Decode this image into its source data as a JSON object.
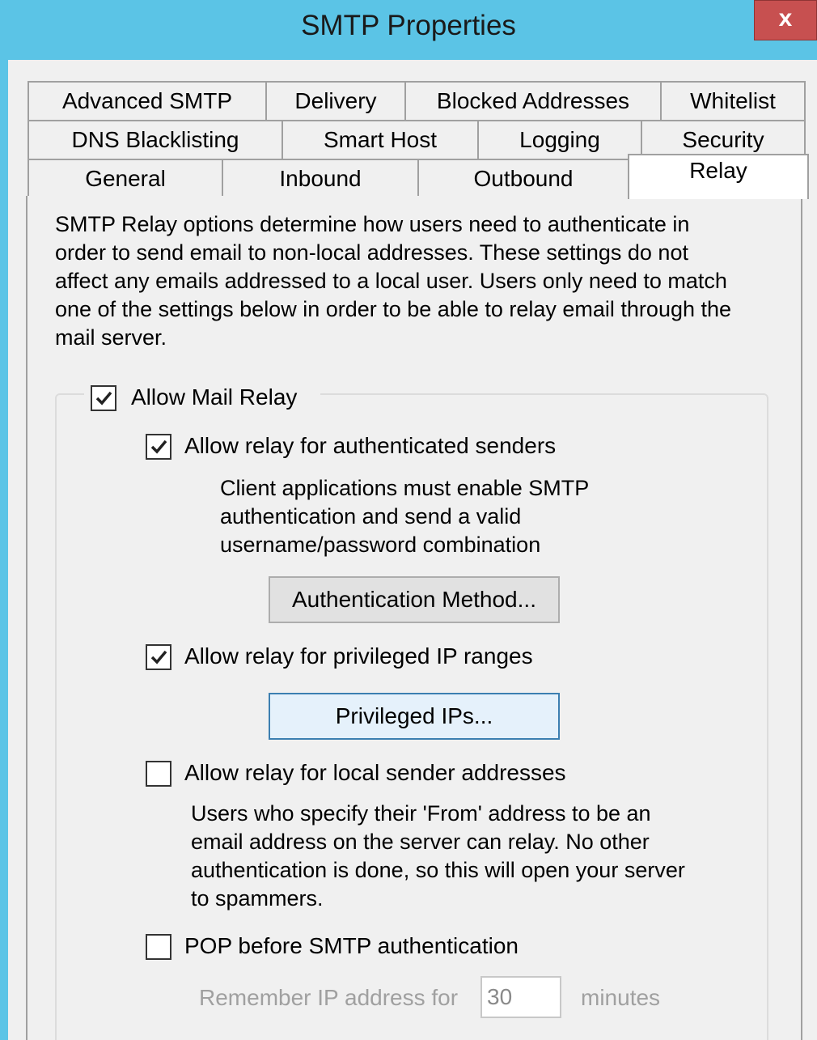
{
  "window": {
    "title": "SMTP Properties",
    "close_glyph": "x"
  },
  "tabs": {
    "row1": [
      "Advanced SMTP",
      "Delivery",
      "Blocked Addresses",
      "Whitelist"
    ],
    "row2": [
      "DNS Blacklisting",
      "Smart Host",
      "Logging",
      "Security"
    ],
    "row3": [
      "General",
      "Inbound",
      "Outbound",
      "Relay"
    ],
    "active": "Relay"
  },
  "description": [
    "SMTP Relay options determine how users need to authenticate in",
    "order to send email to non-local addresses. These settings do not",
    "affect any emails addressed to a local user. Users only need to match",
    "one of the settings below in order to be able to relay email through the",
    "mail server."
  ],
  "allow_mail_relay": {
    "label": "Allow Mail Relay",
    "checked": true
  },
  "auth_senders": {
    "label": "Allow relay for authenticated senders",
    "checked": true,
    "help": [
      "Client applications must enable SMTP",
      "authentication and send a valid",
      "username/password combination"
    ],
    "button": "Authentication Method..."
  },
  "privileged_ips": {
    "label": "Allow relay for privileged IP ranges",
    "checked": true,
    "button": "Privileged IPs..."
  },
  "local_senders": {
    "label": "Allow relay for local sender addresses",
    "checked": false,
    "help": [
      "Users who specify their 'From' address to be an",
      "email address on the server can relay. No other",
      "authentication is done, so this will open your server",
      "to spammers."
    ]
  },
  "pop_before_smtp": {
    "label": "POP before SMTP authentication",
    "checked": false,
    "remember_label": "Remember IP address for",
    "remember_value": "30",
    "remember_unit": "minutes"
  }
}
